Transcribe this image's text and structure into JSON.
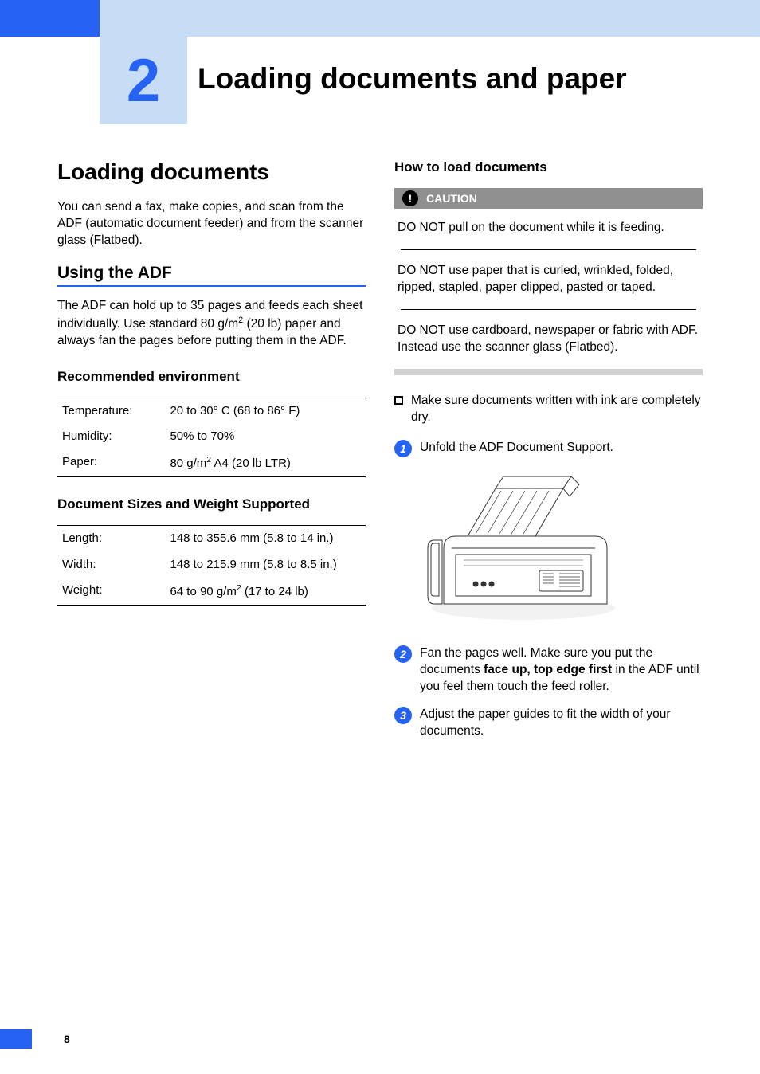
{
  "chapter": {
    "number": "2",
    "title": "Loading documents and paper"
  },
  "left": {
    "h1": "Loading documents",
    "intro": "You can send a fax, make copies, and scan from the ADF (automatic document feeder) and from the scanner glass (Flatbed).",
    "h2": "Using the ADF",
    "adf_text_pre": "The ADF can hold up to 35 pages and feeds each sheet individually. Use standard 80 g/m",
    "adf_text_sup": "2",
    "adf_text_post": " (20 lb) paper and always fan the pages before putting them in the ADF.",
    "h3_env": "Recommended environment",
    "env": {
      "r1k": "Temperature:",
      "r1v": "20 to 30° C (68 to 86° F)",
      "r2k": "Humidity:",
      "r2v": "50% to 70%",
      "r3k": "Paper:",
      "r3v_pre": "80 g/m",
      "r3v_sup": "2",
      "r3v_post": " A4 (20 lb LTR)"
    },
    "h3_sizes": "Document Sizes and Weight Supported",
    "sizes": {
      "r1k": "Length:",
      "r1v": "148 to 355.6 mm (5.8 to 14 in.)",
      "r2k": "Width:",
      "r2v": "148 to 215.9 mm (5.8 to 8.5 in.)",
      "r3k": "Weight:",
      "r3v_pre": "64 to 90 g/m",
      "r3v_sup": "2",
      "r3v_post": " (17 to 24 lb)"
    }
  },
  "right": {
    "h3_howto": "How to load documents",
    "caution_icon": "!",
    "caution_label": "CAUTION",
    "caution1": "DO NOT pull on the document while it is feeding.",
    "caution2": "DO NOT use paper that is curled, wrinkled, folded, ripped, stapled, paper clipped, pasted or taped.",
    "caution3": "DO NOT use cardboard, newspaper or fabric with ADF. Instead use the scanner glass (Flatbed).",
    "bullet1": "Make sure documents written with ink are completely dry.",
    "step1_num": "1",
    "step1": "Unfold the ADF Document Support.",
    "step2_num": "2",
    "step2_pre": "Fan the pages well. Make sure you put the documents ",
    "step2_bold": "face up, top edge first",
    "step2_post": " in the ADF until you feel them touch the feed roller.",
    "step3_num": "3",
    "step3": "Adjust the paper guides to fit the width of your documents."
  },
  "page_number": "8"
}
